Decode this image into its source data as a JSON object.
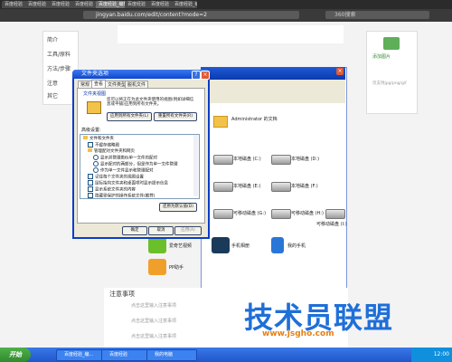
{
  "browser": {
    "tabs": [
      "百度经验",
      "百度经验_编辑器",
      "百度经验",
      "百度经验",
      "百度经验",
      "百度经验_编辑器",
      "百度经验"
    ],
    "url": "jingyan.baidu.com/edit/content?mode=2",
    "search_placeholder": "360搜索"
  },
  "page": {
    "leftnav": [
      "简介",
      "工具/原料",
      "方法/步骤",
      "注意",
      "其它"
    ],
    "right_label": "添加图片",
    "right_hint": "仅支持jpg/png/gif",
    "notes_title": "注意事项",
    "notes_items": [
      "点击这里输入注意事项",
      "点击这里输入注意事项",
      "点击这里输入注意事项"
    ]
  },
  "explorer": {
    "title": "我的电脑",
    "items": [
      {
        "label": "Administrator 的文档"
      },
      {
        "label": "本地磁盘 (C:)"
      },
      {
        "label": "本地磁盘 (D:)"
      },
      {
        "label": "本地磁盘 (E:)"
      },
      {
        "label": "本地磁盘 (F:)"
      },
      {
        "label": "可移动磁盘 (G:)"
      },
      {
        "label": "可移动磁盘 (H:)"
      },
      {
        "label": "可移动磁盘 (I:)"
      }
    ],
    "apps": [
      "手机相册",
      "我的手机"
    ]
  },
  "dialog": {
    "title": "文件夹选项",
    "tabs": [
      "常规",
      "查看",
      "文件类型",
      "脱机文件"
    ],
    "views_label": "文件夹视图",
    "views_desc": "您可以将正在为此文件夹使用的视图(例如详细信息或平铺)应用到所有文件夹。",
    "apply_all": "应用到所有文件夹(L)",
    "reset_all": "重置所有文件夹(R)",
    "advanced_label": "高级设置:",
    "advanced": [
      "文件和文件夹",
      "不缓存缩略图",
      "管理配对文件夹和网页",
      "显示并管理类似单一文件的配对",
      "显示配对的两部分，但是作为单一文件管理",
      "作为单一文件显示和管理配对",
      "记住每个文件夹的视图设置",
      "鼠标指向文件夹和桌面项时显示提示信息",
      "显示系统文件夹的内容",
      "隐藏受保护的操作系统文件(推荐)"
    ],
    "restore": "还原为默认值(D)",
    "ok": "确定",
    "cancel": "取消",
    "apply": "应用(A)"
  },
  "bottom_apps": [
    "爱奇艺视频",
    "PP助手",
    "手机相册",
    "我的手机"
  ],
  "watermark": {
    "text": "技术员联盟",
    "url": "www.jsgho.com"
  },
  "taskbar": {
    "start": "开始",
    "items": [
      "百度经验_编...",
      "百度经验",
      "我的电脑"
    ],
    "clock": "12:00"
  }
}
